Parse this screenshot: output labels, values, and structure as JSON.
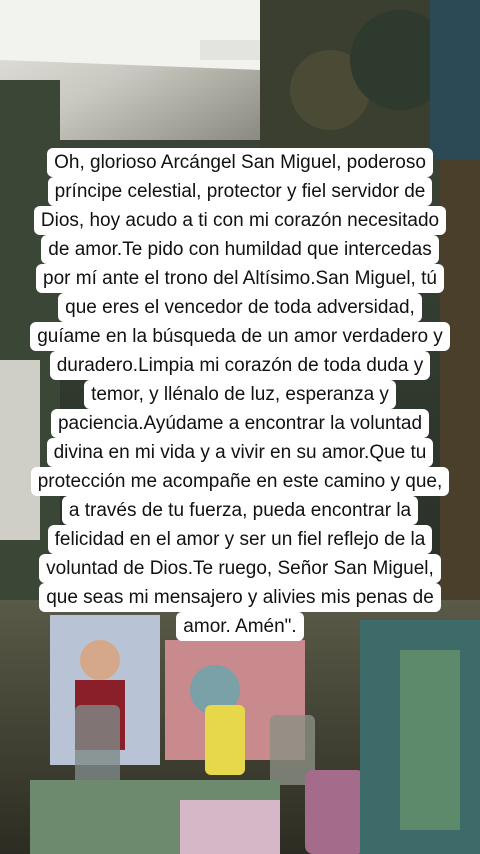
{
  "caption": {
    "lines": [
      "Oh, glorioso Arcángel San Miguel, poderoso",
      "príncipe celestial, protector y fiel servidor de",
      "Dios, hoy acudo a ti con mi corazón necesitado",
      "de amor.Te pido con humildad que intercedas",
      "por mí ante el trono del Altísimo.San Miguel, tú",
      "que eres el vencedor de toda adversidad,",
      "guíame en la búsqueda de un amor verdadero y",
      "duradero.Limpia mi corazón de toda duda y",
      "temor, y llénalo de luz, esperanza y",
      "paciencia.Ayúdame a encontrar la voluntad",
      "divina en mi vida y a vivir en su amor.Que tu",
      "protección me acompañe en este camino y que,",
      "a través de tu fuerza, pueda encontrar la",
      "felicidad en el amor y ser un fiel reflejo de la",
      "voluntad de Dios.Te ruego, Señor San Miguel,",
      "que seas mi mensajero y alivies mis penas de",
      "amor. Amén\"."
    ]
  },
  "colors": {
    "caption_bg": "#ffffff",
    "caption_text": "#111111"
  }
}
